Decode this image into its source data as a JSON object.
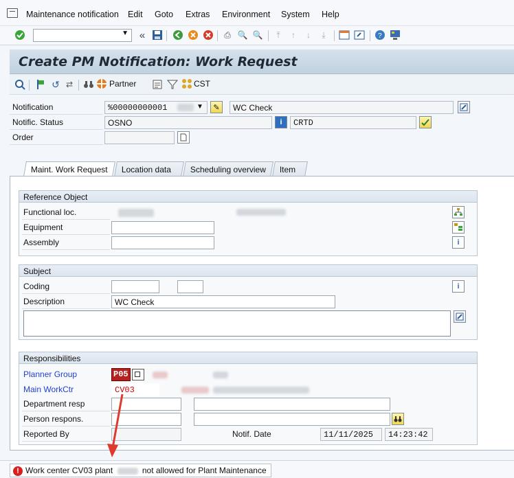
{
  "menubar": {
    "items": [
      "Maintenance notification",
      "Edit",
      "Goto",
      "Extras",
      "Environment",
      "System",
      "Help"
    ]
  },
  "title": "Create PM Notification: Work Request",
  "apptoolbar": {
    "partner_label": "Partner",
    "cst_label": "CST"
  },
  "header": {
    "notification_label": "Notification",
    "notification_value": "%00000000001",
    "notification_desc": "WC Check",
    "status_label": "Notific. Status",
    "status_value": "OSNO",
    "status_code": "CRTD",
    "order_label": "Order",
    "order_value": ""
  },
  "tabs": [
    "Maint. Work Request",
    "Location data",
    "Scheduling overview",
    "Item"
  ],
  "reference_object": {
    "title": "Reference Object",
    "functional_loc_label": "Functional loc.",
    "equipment_label": "Equipment",
    "assembly_label": "Assembly"
  },
  "subject": {
    "title": "Subject",
    "coding_label": "Coding",
    "description_label": "Description",
    "description_value": "WC Check"
  },
  "responsibilities": {
    "title": "Responsibilities",
    "planner_group_label": "Planner Group",
    "planner_group_value": "P05",
    "main_workctr_label": "Main WorkCtr",
    "main_workctr_value": "CV03",
    "department_label": "Department resp",
    "person_label": "Person respons.",
    "reported_by_label": "Reported By",
    "notif_date_label": "Notif. Date",
    "notif_date_value": "11/11/2025",
    "notif_time_value": "14:23:42"
  },
  "status": {
    "msg_prefix": "Work center CV03 plant",
    "msg_suffix": "not allowed for Plant Maintenance"
  },
  "colors": {
    "error": "#d91f1f",
    "link_label": "#1f3fd6",
    "title_bg": "#c9d7e5"
  }
}
